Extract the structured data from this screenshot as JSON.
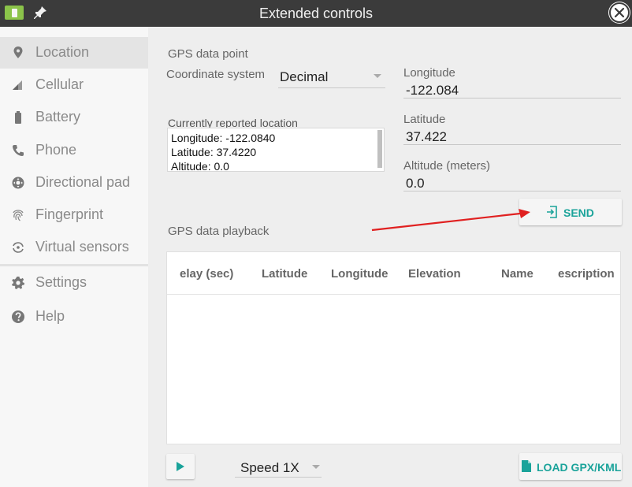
{
  "window": {
    "title": "Extended controls"
  },
  "sidebar": {
    "items": [
      {
        "label": "Location",
        "icon": "location-pin-icon"
      },
      {
        "label": "Cellular",
        "icon": "signal-icon"
      },
      {
        "label": "Battery",
        "icon": "battery-icon"
      },
      {
        "label": "Phone",
        "icon": "phone-icon"
      },
      {
        "label": "Directional pad",
        "icon": "dpad-icon"
      },
      {
        "label": "Fingerprint",
        "icon": "fingerprint-icon"
      },
      {
        "label": "Virtual sensors",
        "icon": "rotate-icon"
      },
      {
        "label": "Settings",
        "icon": "gear-icon"
      },
      {
        "label": "Help",
        "icon": "help-icon"
      }
    ],
    "selected": "Location"
  },
  "gps_point": {
    "section_title": "GPS data point",
    "coordinate_system_label": "Coordinate system",
    "coordinate_system_value": "Decimal",
    "longitude_label": "Longitude",
    "longitude_value": "-122.084",
    "latitude_label": "Latitude",
    "latitude_value": "37.422",
    "altitude_label": "Altitude (meters)",
    "altitude_value": "0.0",
    "reported_caption": "Currently reported location",
    "reported_lines": [
      "Longitude: -122.0840",
      "Latitude: 37.4220",
      "Altitude: 0.0"
    ],
    "send_label": "SEND"
  },
  "playback": {
    "section_title": "GPS data playback",
    "columns": [
      "elay (sec)",
      "Latitude",
      "Longitude",
      "Elevation",
      "Name",
      "escription"
    ],
    "speed_value": "Speed 1X",
    "load_label": "LOAD GPX/KML"
  },
  "colors": {
    "accent": "#1aa39a",
    "annotation_arrow": "#e02020",
    "titlebar": "#3b3b3b"
  }
}
